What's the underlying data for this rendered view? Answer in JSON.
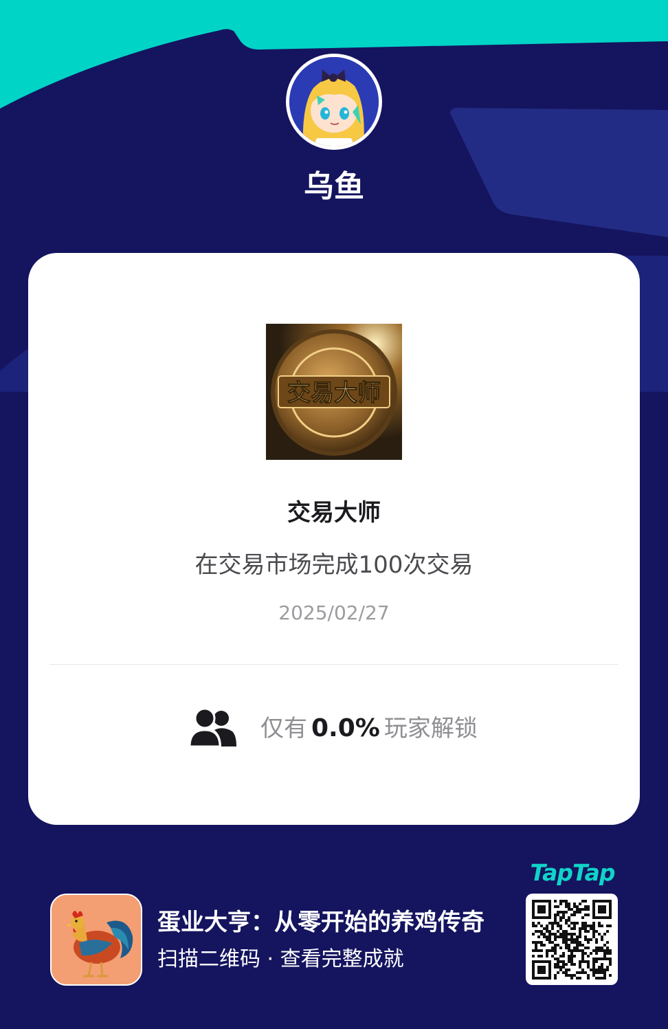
{
  "profile": {
    "username": "乌鱼"
  },
  "achievement": {
    "title": "交易大师",
    "description": "在交易市场完成100次交易",
    "date": "2025/02/27",
    "badge_text": "交易大师",
    "unlock_prefix": "仅有",
    "unlock_percent": "0.0%",
    "unlock_suffix": "玩家解锁"
  },
  "game": {
    "title": "蛋业大亨：从零开始的养鸡传奇",
    "subtitle": "扫描二维码 · 查看完整成就"
  },
  "brand": {
    "name": "TapTap"
  },
  "colors": {
    "background": "#15145f",
    "top_accent": "#00d4c6",
    "brand": "#10d4c8",
    "card": "#ffffff"
  },
  "icons": {
    "unlock": "users-icon",
    "game": "rooster-icon",
    "qr": "qr-code"
  }
}
